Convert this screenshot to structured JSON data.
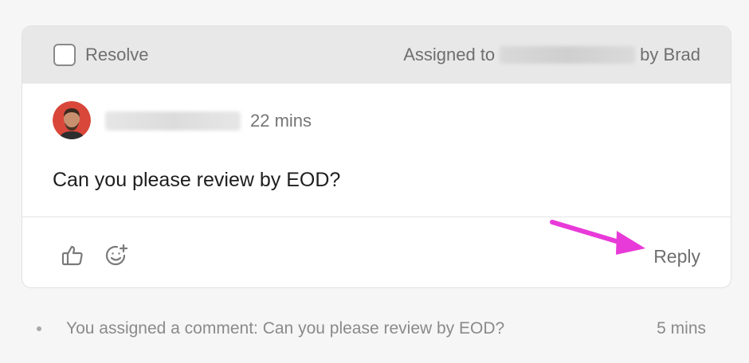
{
  "card": {
    "header": {
      "resolve_label": "Resolve",
      "assigned_prefix": "Assigned to",
      "assigned_by": "by Brad"
    },
    "comment": {
      "time": "22 mins",
      "text": "Can you please review by EOD?"
    },
    "actions": {
      "like_icon": "thumbs-up-icon",
      "reaction_icon": "add-emoji-icon",
      "reply_label": "Reply"
    }
  },
  "activity": {
    "text": "You assigned a comment: Can you please review by EOD?",
    "time": "5 mins"
  },
  "colors": {
    "header_bg": "#e8e8e8",
    "annotation_arrow": "#e83ad8"
  }
}
